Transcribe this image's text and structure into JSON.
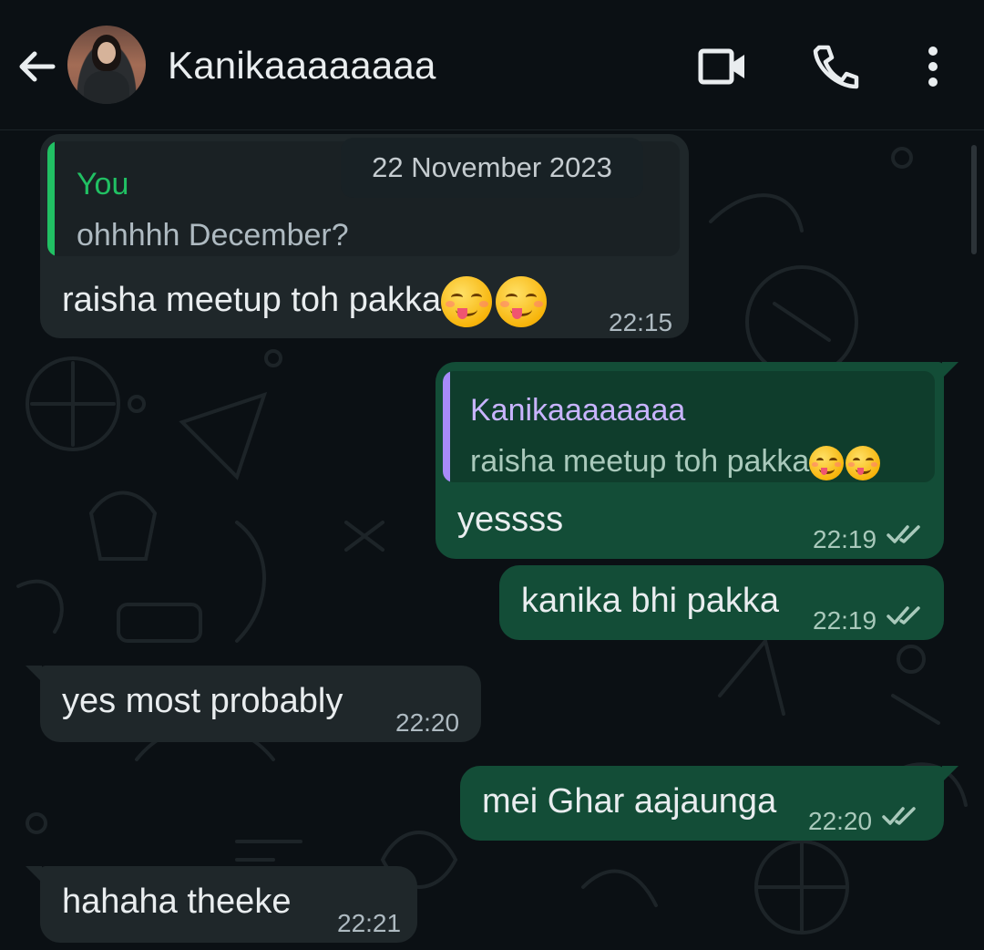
{
  "header": {
    "contact_name": "Kanikaaaaaaaa",
    "back_icon": "arrow-left-icon",
    "avatar": "contact-avatar",
    "video_icon": "video-camera-icon",
    "call_icon": "phone-icon",
    "menu_icon": "more-vertical-icon"
  },
  "chat": {
    "date_chip": "22 November 2023",
    "messages": [
      {
        "direction": "in",
        "quote_name": "You",
        "quote_text": "ohhhhh December?",
        "text": "raisha meetup toh pakka",
        "emoji": "😋😋",
        "time": "22:15"
      },
      {
        "direction": "out",
        "quote_name": "Kanikaaaaaaaa",
        "quote_text": "raisha meetup toh pakka",
        "quote_emoji": "😋😋",
        "text": "yessss",
        "time": "22:19",
        "status": "read"
      },
      {
        "direction": "out",
        "text": "kanika bhi pakka",
        "time": "22:19",
        "status": "read"
      },
      {
        "direction": "in",
        "text": "yes most probably",
        "time": "22:20"
      },
      {
        "direction": "out",
        "text": "mei Ghar aajaunga",
        "time": "22:20",
        "status": "read"
      },
      {
        "direction": "in",
        "text": "hahaha theeke",
        "time": "22:21"
      }
    ]
  },
  "colors": {
    "background": "#0b1014",
    "incoming_bubble": "#1f272a",
    "outgoing_bubble": "#134d37",
    "quote_you_accent": "#21c063",
    "quote_contact_accent": "#a78bfa",
    "tick_color": "#a9c9bb"
  }
}
